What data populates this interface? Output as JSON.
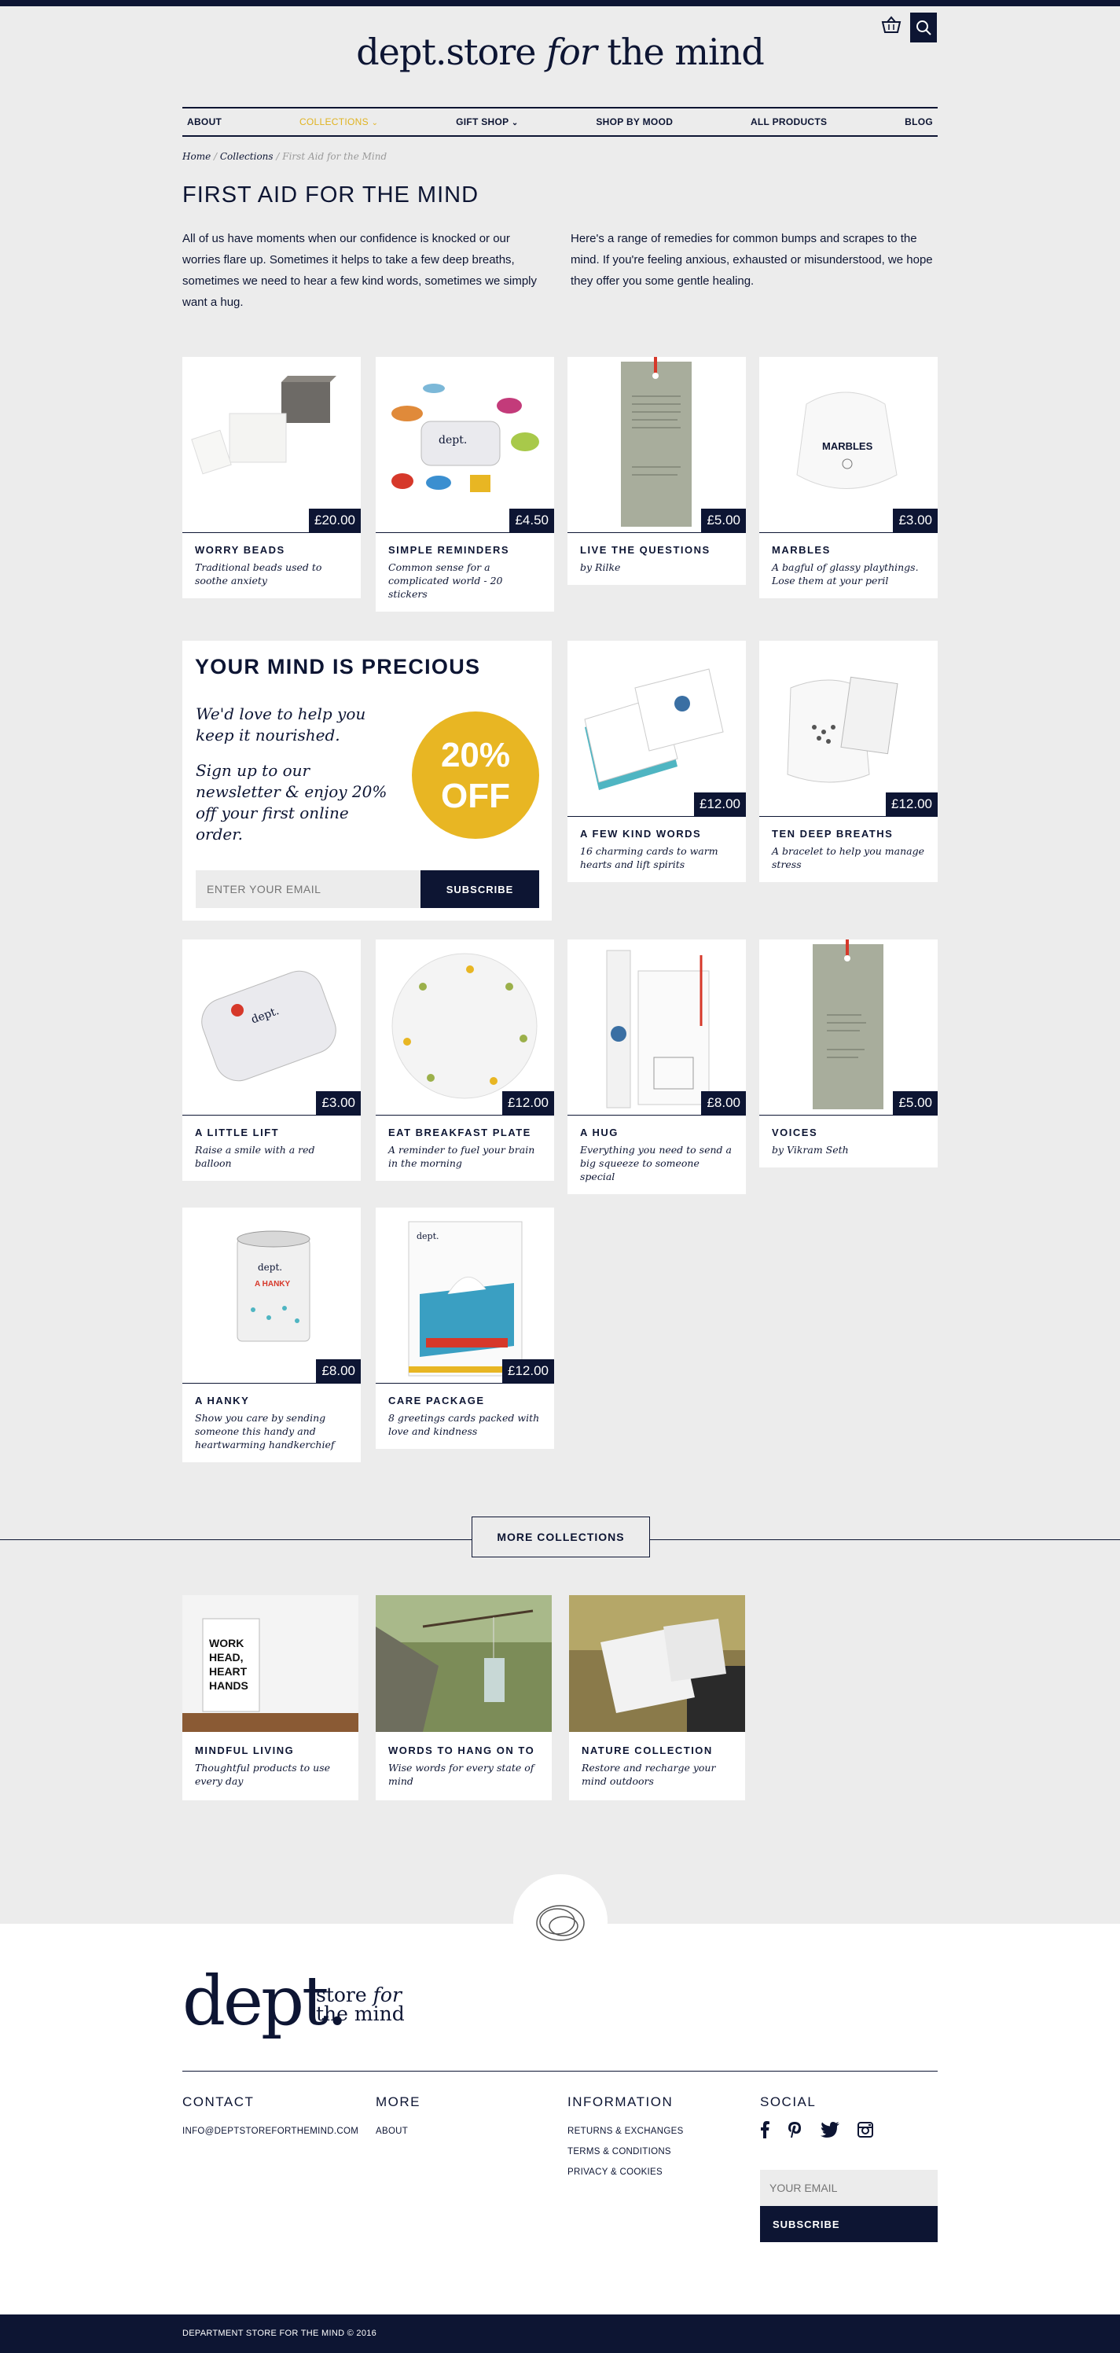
{
  "header": {
    "logo_main": "dept.store",
    "logo_italic": "for",
    "logo_end": "the mind"
  },
  "nav": {
    "items": [
      "ABOUT",
      "COLLECTIONS",
      "GIFT SHOP",
      "SHOP BY MOOD",
      "ALL PRODUCTS",
      "BLOG"
    ],
    "active": "COLLECTIONS"
  },
  "breadcrumb": {
    "home": "Home",
    "sep": "/",
    "collections": "Collections",
    "current": "First Aid for the Mind"
  },
  "page": {
    "title": "FIRST AID FOR THE MIND",
    "intro_left": "All of us have moments when our confidence is knocked or our worries flare up. Sometimes it helps to take a few deep breaths, sometimes we need to hear a few kind words, sometimes we simply want a hug.",
    "intro_right": "Here's a range of remedies for common bumps and scrapes to the mind. If you're feeling anxious, exhausted or misunderstood, we hope they offer you some gentle healing."
  },
  "products": [
    {
      "name": "WORRY BEADS",
      "desc": "Traditional beads used to soothe anxiety",
      "price": "£20.00"
    },
    {
      "name": "SIMPLE REMINDERS",
      "desc": "Common sense for a complicated world - 20 stickers",
      "price": "£4.50"
    },
    {
      "name": "LIVE THE QUESTIONS",
      "desc": "by Rilke",
      "price": "£5.00"
    },
    {
      "name": "MARBLES",
      "desc": "A bagful of glassy playthings. Lose them at your peril",
      "price": "£3.00"
    },
    {
      "name": "A FEW KIND WORDS",
      "desc": "16 charming cards to warm hearts and lift spirits",
      "price": "£12.00"
    },
    {
      "name": "TEN DEEP BREATHS",
      "desc": "A bracelet to help you manage stress",
      "price": "£12.00"
    },
    {
      "name": "A LITTLE LIFT",
      "desc": "Raise a smile with a red balloon",
      "price": "£3.00"
    },
    {
      "name": "EAT BREAKFAST PLATE",
      "desc": "A reminder to fuel your brain in the morning",
      "price": "£12.00"
    },
    {
      "name": "A HUG",
      "desc": "Everything you need to send a big squeeze to someone special",
      "price": "£8.00"
    },
    {
      "name": "VOICES",
      "desc": "by Vikram Seth",
      "price": "£5.00"
    },
    {
      "name": "A HANKY",
      "desc": "Show you care by sending someone this handy and heartwarming handkerchief",
      "price": "£8.00"
    },
    {
      "name": "CARE PACKAGE",
      "desc": "8 greetings cards packed with love and kindness",
      "price": "£12.00"
    }
  ],
  "promo": {
    "title": "YOUR MIND IS PRECIOUS",
    "line1": "We'd love to help you keep it nourished.",
    "line2": "Sign up to our newsletter & enjoy 20% off your first online order.",
    "badge_top": "20%",
    "badge_bottom": "OFF",
    "email_placeholder": "ENTER YOUR EMAIL",
    "subscribe": "SUBSCRIBE"
  },
  "more_collections": {
    "button": "MORE COLLECTIONS",
    "items": [
      {
        "name": "MINDFUL LIVING",
        "desc": "Thoughtful products to use every day"
      },
      {
        "name": "WORDS TO HANG ON TO",
        "desc": "Wise words for every state of mind"
      },
      {
        "name": "NATURE COLLECTION",
        "desc": "Restore and recharge your mind outdoors"
      }
    ]
  },
  "footer": {
    "logo_big": "dept.",
    "logo_small_1": "store",
    "logo_small_it": "for",
    "logo_small_2": "the mind",
    "contact": {
      "title": "CONTACT",
      "email": "INFO@DEPTSTOREFORTHEMIND.COM"
    },
    "more": {
      "title": "MORE",
      "links": [
        "ABOUT"
      ]
    },
    "information": {
      "title": "INFORMATION",
      "links": [
        "RETURNS & EXCHANGES",
        "TERMS & CONDITIONS",
        "PRIVACY & COOKIES"
      ]
    },
    "social": {
      "title": "SOCIAL",
      "icons": [
        "facebook-icon",
        "pinterest-icon",
        "twitter-icon",
        "instagram-icon"
      ]
    },
    "email_placeholder": "YOUR EMAIL",
    "subscribe": "SUBSCRIBE",
    "copyright": "DEPARTMENT STORE FOR THE MIND © 2016"
  },
  "colors": {
    "navy": "#0d1533",
    "accent": "#e0b321",
    "bg": "#ececec"
  }
}
